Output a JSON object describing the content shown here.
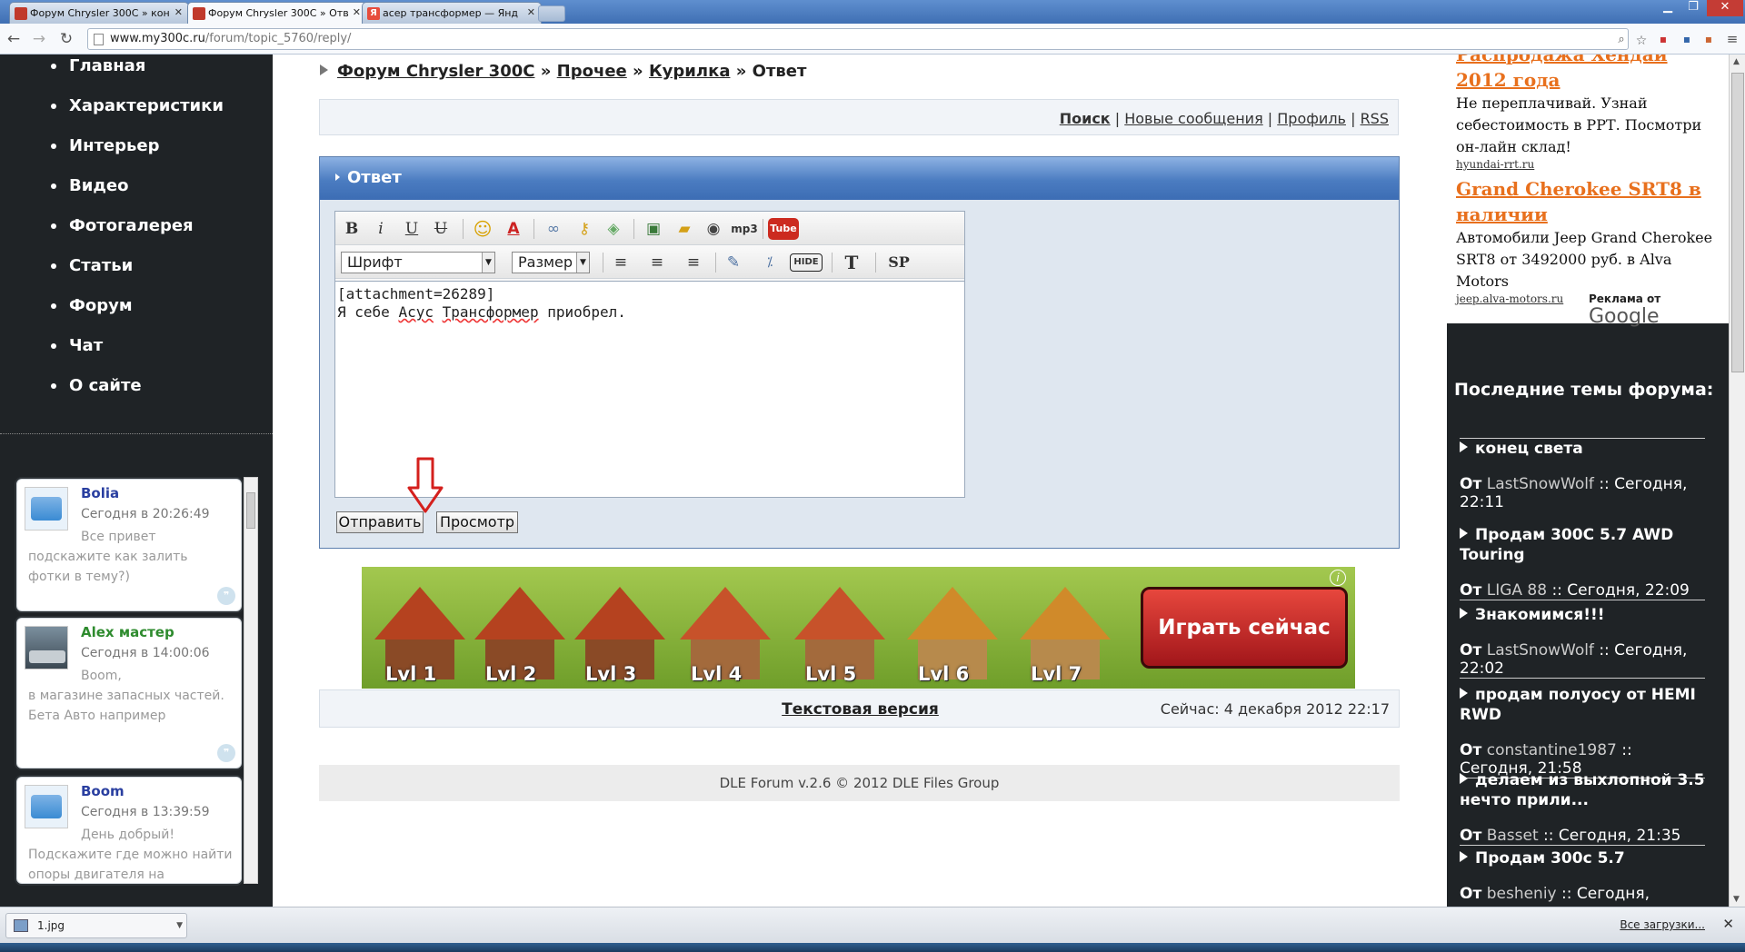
{
  "browser": {
    "tabs": [
      {
        "label": "Форум Chrysler 300C » кон",
        "active": false
      },
      {
        "label": "Форум Chrysler 300C » Отв",
        "active": true
      },
      {
        "label": "асер трансформер — Янд",
        "active": false
      }
    ],
    "url_host": "www.my300c.ru",
    "url_path": "/forum/topic_5760/reply/"
  },
  "sidebar": {
    "menu": [
      "Главная",
      "Характеристики",
      "Интерьер",
      "Видео",
      "Фотогалерея",
      "Статьи",
      "Форум",
      "Чат",
      "О сайте"
    ]
  },
  "chat": {
    "messages": [
      {
        "name": "Bolia",
        "name_color": "#2a3fa0",
        "time": "Сегодня в 20:26:49",
        "text": "Все привет подскажите как залить фотки в тему?)"
      },
      {
        "name": "Alex мастер",
        "name_color": "#2e8b2e",
        "time": "Сегодня в 14:00:06",
        "text": "Boom,\nв магазине запасных частей.\nБета Авто например"
      },
      {
        "name": "Boom",
        "name_color": "#2a3fa0",
        "time": "Сегодня в 13:39:59",
        "text": "День добрый! Подскажите где можно найти опоры двигателя на"
      }
    ]
  },
  "breadcrumb": {
    "items": [
      "Форум Chrysler 300C",
      "Прочее",
      "Курилка"
    ],
    "sep": "»",
    "current": "Ответ"
  },
  "toplinks": {
    "search": "Поиск",
    "new_posts": "Новые сообщения",
    "profile": "Профиль",
    "rss": "RSS",
    "sep": "|"
  },
  "reply": {
    "header": "Ответ",
    "font_select": "Шрифт",
    "size_select": "Размер",
    "mp3_label": "mp3",
    "hide_label": "HIDE",
    "sp_label": "SP",
    "text_line1": "[attachment=26289]",
    "text_line2_a": "Я себе ",
    "text_line2_b": "Асус",
    "text_line2_c": " ",
    "text_line2_d": "Трансформер",
    "text_line2_e": " приобрел.",
    "submit": "Отправить",
    "preview": "Просмотр"
  },
  "banner": {
    "levels": [
      "Lvl 1",
      "Lvl 2",
      "Lvl 3",
      "Lvl 4",
      "Lvl 5",
      "Lvl 6",
      "Lvl 7"
    ],
    "cta": "Играть сейчас",
    "info_icon": "i"
  },
  "status": {
    "text_version": "Текстовая версия",
    "now": "Сейчас: 4 декабря 2012 22:17"
  },
  "footer": {
    "copyright": "DLE Forum v.2.6 © 2012 DLE Files Group"
  },
  "ads": [
    {
      "title": "Распродажа Хендай 2012 года",
      "desc": "Не переплачивай. Узнай себестоимость в РРТ. Посмотри он-лайн склад!",
      "url": "hyundai-rrt.ru"
    },
    {
      "title": "Grand Cherokee SRT8 в наличии",
      "desc": "Автомобили Jeep Grand Cherokee SRT8 от 3492000 руб. в Alva Motors",
      "url": "jeep.alva-motors.ru"
    }
  ],
  "ads_by": "Реклама от",
  "ads_by_brand": "Google",
  "latest": {
    "title": "Последние темы форума:",
    "from_label": "От",
    "topics": [
      {
        "title": "конец света",
        "author": "LastSnowWolf",
        "time": ":: Сегодня, 22:11"
      },
      {
        "title": "Продам 300С 5.7 AWD Touring",
        "author": "LIGA 88",
        "time": ":: Сегодня, 22:09"
      },
      {
        "title": "Знакомимся!!!",
        "author": "LastSnowWolf",
        "time": ":: Сегодня, 22:02"
      },
      {
        "title": "продам полуосу от HEMI RWD",
        "author": "constantine1987",
        "time": ":: Сегодня, 21:58"
      },
      {
        "title": "делаем из выхлопной 3.5 нечто прили...",
        "author": "Basset",
        "time": ":: Сегодня, 21:35"
      },
      {
        "title": "Продам 300с 5.7",
        "author": "besheniy",
        "time": ":: Сегодня,"
      }
    ]
  },
  "downloads": {
    "file": "1.jpg",
    "all": "Все загрузки..."
  }
}
